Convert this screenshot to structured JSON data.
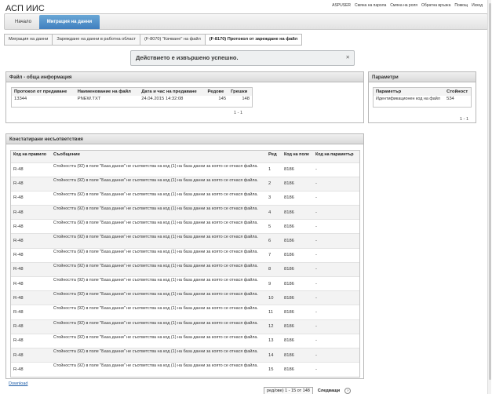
{
  "app": {
    "title": "АСП ИИС"
  },
  "toplinks": [
    "ASPUSER",
    "Смяна на парола",
    "Смяна на роля",
    "Обратна връзка",
    "Помощ",
    "Изход"
  ],
  "nav": {
    "home": "Начало",
    "active": "Миграция на данни"
  },
  "breadcrumb": [
    "Миграция на данни",
    "Зареждане на данни в работна област",
    "(F-8070) \"Качване\" на файл",
    "(F-8170) Протокол от зареждане на файл"
  ],
  "message": {
    "text": "Действието е извършено успешно.",
    "close": "✕"
  },
  "file_panel": {
    "title": "Файл - обща информация",
    "headers": [
      "Протокол от предаване",
      "Наименование на файл",
      "Дата и час на предаване",
      "Редове",
      "Грешки"
    ],
    "row": [
      "13344",
      "PNEW.TXT",
      "24.04.2015 14:32:08",
      "145",
      "148"
    ],
    "pager": "1 - 1"
  },
  "params_panel": {
    "title": "Параметри",
    "headers": [
      "Параметър",
      "Стойност"
    ],
    "row": [
      "Идентификационен код на файл",
      "534"
    ],
    "pager": "1 - 1"
  },
  "nc_panel": {
    "title": "Констатирани несъответствия",
    "headers": [
      "Код на правило",
      "Съобщение",
      "Ред",
      "Код на поле",
      "Код на параметър"
    ],
    "rule": "R-48",
    "message": "Стойността (92) в поле \"База данни\" не съответства на код (1) на база данни за която се отнася файла.",
    "field": "8186",
    "param": "-",
    "rows": [
      "1",
      "2",
      "3",
      "4",
      "5",
      "6",
      "7",
      "8",
      "9",
      "10",
      "11",
      "12",
      "13",
      "14",
      "15"
    ]
  },
  "footer": {
    "download": "Download",
    "page_info": "ред/ове) 1 - 15 от 148",
    "next": "Следващи",
    "next_icon": "›"
  }
}
